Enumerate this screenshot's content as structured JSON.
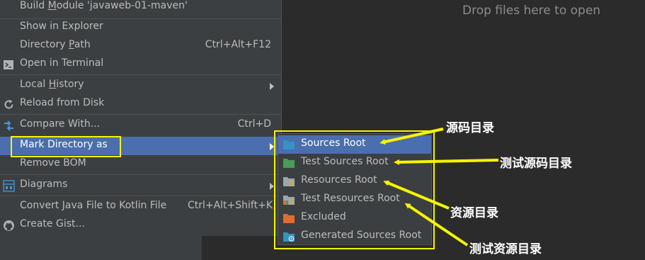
{
  "editor": {
    "drop_text": "Drop files here to open"
  },
  "menu": {
    "build_module": {
      "prefix": "Build ",
      "mnemonic": "M",
      "suffix": "odule 'javaweb-01-maven'"
    },
    "show_in_explorer": "Show in Explorer",
    "directory_path": {
      "prefix": "Directory ",
      "mnemonic": "P",
      "suffix": "ath",
      "shortcut": "Ctrl+Alt+F12"
    },
    "open_in_terminal": "Open in Terminal",
    "local_history": {
      "prefix": "Local ",
      "mnemonic": "H",
      "suffix": "istory"
    },
    "reload_from_disk": "Reload from Disk",
    "compare_with": {
      "label": "Compare With...",
      "shortcut": "Ctrl+D"
    },
    "mark_directory_as": "Mark Directory as",
    "remove_bom": "Remove BOM",
    "diagrams": "Diagrams",
    "convert_java_to_kotlin": {
      "label": "Convert Java File to Kotlin File",
      "shortcut": "Ctrl+Alt+Shift+K"
    },
    "create_gist": "Create Gist..."
  },
  "submenu": {
    "items": [
      {
        "label": "Sources Root",
        "color": "#3592c4"
      },
      {
        "label": "Test Sources Root",
        "color": "#499c54"
      },
      {
        "label": "Resources Root",
        "color": "#9aa7b0"
      },
      {
        "label": "Test Resources Root",
        "color": "#9aa7b0"
      },
      {
        "label": "Excluded",
        "color": "#e06c2f"
      },
      {
        "label": "Generated Sources Root",
        "color": "#3592c4"
      }
    ]
  },
  "annotations": {
    "sources_root": "源码目录",
    "test_sources_root": "测试源码目录",
    "resources_root": "资源目录",
    "test_resources_root": "测试资源目录"
  },
  "colors": {
    "highlight_box": "#f5f500",
    "selection": "#4b6eaf",
    "menu_bg": "#3c3f41"
  }
}
